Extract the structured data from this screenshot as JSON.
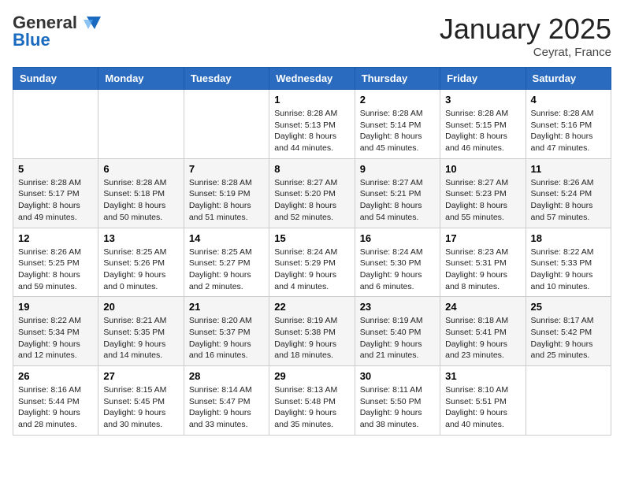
{
  "logo": {
    "general": "General",
    "blue": "Blue"
  },
  "title": "January 2025",
  "location": "Ceyrat, France",
  "days_header": [
    "Sunday",
    "Monday",
    "Tuesday",
    "Wednesday",
    "Thursday",
    "Friday",
    "Saturday"
  ],
  "weeks": [
    [
      {
        "day": "",
        "sunrise": "",
        "sunset": "",
        "daylight": ""
      },
      {
        "day": "",
        "sunrise": "",
        "sunset": "",
        "daylight": ""
      },
      {
        "day": "",
        "sunrise": "",
        "sunset": "",
        "daylight": ""
      },
      {
        "day": "1",
        "sunrise": "Sunrise: 8:28 AM",
        "sunset": "Sunset: 5:13 PM",
        "daylight": "Daylight: 8 hours and 44 minutes."
      },
      {
        "day": "2",
        "sunrise": "Sunrise: 8:28 AM",
        "sunset": "Sunset: 5:14 PM",
        "daylight": "Daylight: 8 hours and 45 minutes."
      },
      {
        "day": "3",
        "sunrise": "Sunrise: 8:28 AM",
        "sunset": "Sunset: 5:15 PM",
        "daylight": "Daylight: 8 hours and 46 minutes."
      },
      {
        "day": "4",
        "sunrise": "Sunrise: 8:28 AM",
        "sunset": "Sunset: 5:16 PM",
        "daylight": "Daylight: 8 hours and 47 minutes."
      }
    ],
    [
      {
        "day": "5",
        "sunrise": "Sunrise: 8:28 AM",
        "sunset": "Sunset: 5:17 PM",
        "daylight": "Daylight: 8 hours and 49 minutes."
      },
      {
        "day": "6",
        "sunrise": "Sunrise: 8:28 AM",
        "sunset": "Sunset: 5:18 PM",
        "daylight": "Daylight: 8 hours and 50 minutes."
      },
      {
        "day": "7",
        "sunrise": "Sunrise: 8:28 AM",
        "sunset": "Sunset: 5:19 PM",
        "daylight": "Daylight: 8 hours and 51 minutes."
      },
      {
        "day": "8",
        "sunrise": "Sunrise: 8:27 AM",
        "sunset": "Sunset: 5:20 PM",
        "daylight": "Daylight: 8 hours and 52 minutes."
      },
      {
        "day": "9",
        "sunrise": "Sunrise: 8:27 AM",
        "sunset": "Sunset: 5:21 PM",
        "daylight": "Daylight: 8 hours and 54 minutes."
      },
      {
        "day": "10",
        "sunrise": "Sunrise: 8:27 AM",
        "sunset": "Sunset: 5:23 PM",
        "daylight": "Daylight: 8 hours and 55 minutes."
      },
      {
        "day": "11",
        "sunrise": "Sunrise: 8:26 AM",
        "sunset": "Sunset: 5:24 PM",
        "daylight": "Daylight: 8 hours and 57 minutes."
      }
    ],
    [
      {
        "day": "12",
        "sunrise": "Sunrise: 8:26 AM",
        "sunset": "Sunset: 5:25 PM",
        "daylight": "Daylight: 8 hours and 59 minutes."
      },
      {
        "day": "13",
        "sunrise": "Sunrise: 8:25 AM",
        "sunset": "Sunset: 5:26 PM",
        "daylight": "Daylight: 9 hours and 0 minutes."
      },
      {
        "day": "14",
        "sunrise": "Sunrise: 8:25 AM",
        "sunset": "Sunset: 5:27 PM",
        "daylight": "Daylight: 9 hours and 2 minutes."
      },
      {
        "day": "15",
        "sunrise": "Sunrise: 8:24 AM",
        "sunset": "Sunset: 5:29 PM",
        "daylight": "Daylight: 9 hours and 4 minutes."
      },
      {
        "day": "16",
        "sunrise": "Sunrise: 8:24 AM",
        "sunset": "Sunset: 5:30 PM",
        "daylight": "Daylight: 9 hours and 6 minutes."
      },
      {
        "day": "17",
        "sunrise": "Sunrise: 8:23 AM",
        "sunset": "Sunset: 5:31 PM",
        "daylight": "Daylight: 9 hours and 8 minutes."
      },
      {
        "day": "18",
        "sunrise": "Sunrise: 8:22 AM",
        "sunset": "Sunset: 5:33 PM",
        "daylight": "Daylight: 9 hours and 10 minutes."
      }
    ],
    [
      {
        "day": "19",
        "sunrise": "Sunrise: 8:22 AM",
        "sunset": "Sunset: 5:34 PM",
        "daylight": "Daylight: 9 hours and 12 minutes."
      },
      {
        "day": "20",
        "sunrise": "Sunrise: 8:21 AM",
        "sunset": "Sunset: 5:35 PM",
        "daylight": "Daylight: 9 hours and 14 minutes."
      },
      {
        "day": "21",
        "sunrise": "Sunrise: 8:20 AM",
        "sunset": "Sunset: 5:37 PM",
        "daylight": "Daylight: 9 hours and 16 minutes."
      },
      {
        "day": "22",
        "sunrise": "Sunrise: 8:19 AM",
        "sunset": "Sunset: 5:38 PM",
        "daylight": "Daylight: 9 hours and 18 minutes."
      },
      {
        "day": "23",
        "sunrise": "Sunrise: 8:19 AM",
        "sunset": "Sunset: 5:40 PM",
        "daylight": "Daylight: 9 hours and 21 minutes."
      },
      {
        "day": "24",
        "sunrise": "Sunrise: 8:18 AM",
        "sunset": "Sunset: 5:41 PM",
        "daylight": "Daylight: 9 hours and 23 minutes."
      },
      {
        "day": "25",
        "sunrise": "Sunrise: 8:17 AM",
        "sunset": "Sunset: 5:42 PM",
        "daylight": "Daylight: 9 hours and 25 minutes."
      }
    ],
    [
      {
        "day": "26",
        "sunrise": "Sunrise: 8:16 AM",
        "sunset": "Sunset: 5:44 PM",
        "daylight": "Daylight: 9 hours and 28 minutes."
      },
      {
        "day": "27",
        "sunrise": "Sunrise: 8:15 AM",
        "sunset": "Sunset: 5:45 PM",
        "daylight": "Daylight: 9 hours and 30 minutes."
      },
      {
        "day": "28",
        "sunrise": "Sunrise: 8:14 AM",
        "sunset": "Sunset: 5:47 PM",
        "daylight": "Daylight: 9 hours and 33 minutes."
      },
      {
        "day": "29",
        "sunrise": "Sunrise: 8:13 AM",
        "sunset": "Sunset: 5:48 PM",
        "daylight": "Daylight: 9 hours and 35 minutes."
      },
      {
        "day": "30",
        "sunrise": "Sunrise: 8:11 AM",
        "sunset": "Sunset: 5:50 PM",
        "daylight": "Daylight: 9 hours and 38 minutes."
      },
      {
        "day": "31",
        "sunrise": "Sunrise: 8:10 AM",
        "sunset": "Sunset: 5:51 PM",
        "daylight": "Daylight: 9 hours and 40 minutes."
      },
      {
        "day": "",
        "sunrise": "",
        "sunset": "",
        "daylight": ""
      }
    ]
  ]
}
